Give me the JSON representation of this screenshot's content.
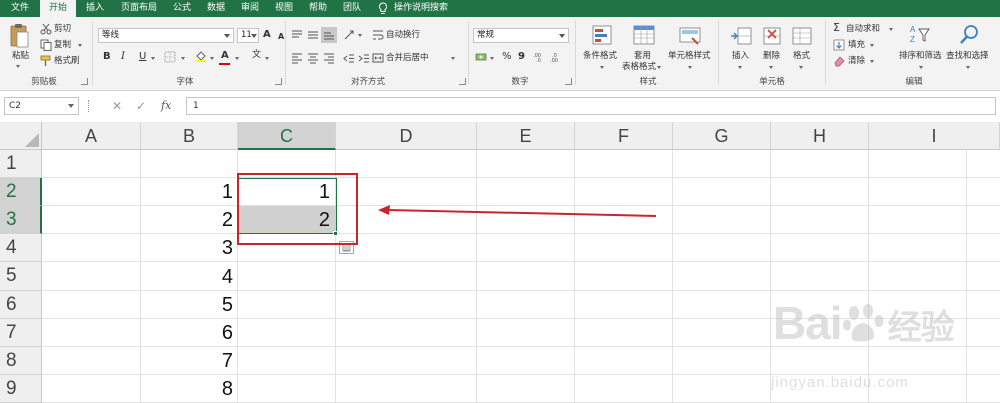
{
  "menu": {
    "tabs": [
      {
        "label": "文件"
      },
      {
        "label": "开始"
      },
      {
        "label": "插入"
      },
      {
        "label": "页面布局"
      },
      {
        "label": "公式"
      },
      {
        "label": "数据"
      },
      {
        "label": "审阅"
      },
      {
        "label": "视图"
      },
      {
        "label": "帮助"
      },
      {
        "label": "团队"
      }
    ],
    "tell_me": "操作说明搜索",
    "active_color": "#217346"
  },
  "ribbon": {
    "clipboard": {
      "paste": "粘贴",
      "cut": "剪切",
      "copy": "复制",
      "format_painter": "格式刷",
      "label": "剪贴板"
    },
    "font": {
      "name": "等线",
      "size": "11",
      "bold": "B",
      "italic": "I",
      "underline": "U",
      "grow": "A",
      "shrink": "A",
      "text_color_glyph": "A",
      "wen": "文",
      "label": "字体"
    },
    "alignment": {
      "wrap": "自动换行",
      "merge": "合并后居中",
      "label": "对齐方式"
    },
    "number": {
      "format": "常规",
      "percent": "%",
      "comma": "9",
      "label": "数字"
    },
    "styles": {
      "conditional": "条件格式",
      "table1": "套用",
      "table2": "表格格式",
      "cell_styles": "单元格样式",
      "label": "样式"
    },
    "cells": {
      "insert": "插入",
      "delete": "删除",
      "format": "格式",
      "label": "单元格"
    },
    "editing": {
      "autosum": "自动求和",
      "fill": "填充",
      "clear": "清除",
      "sort": "排序和筛选",
      "find": "查找和选择",
      "label": "编辑"
    }
  },
  "formula_bar": {
    "name_box": "C2",
    "cancel": "✕",
    "confirm": "✓",
    "fx": "fx",
    "value": "1"
  },
  "sheet": {
    "columns": [
      "A",
      "B",
      "C",
      "D",
      "E",
      "F",
      "G",
      "H",
      "I"
    ],
    "rows": [
      "1",
      "2",
      "3",
      "4",
      "5",
      "6",
      "7",
      "8",
      "9"
    ],
    "col_b": [
      "",
      "1",
      "2",
      "3",
      "4",
      "5",
      "6",
      "7",
      "8"
    ],
    "col_c": [
      "",
      "1",
      "2"
    ]
  },
  "watermark": {
    "brand": "Bai",
    "brand2": "经验",
    "url": "jingyan.baidu.com"
  },
  "colors": {
    "excel_green": "#217346",
    "annotation_red": "#c9252c",
    "font_red": "#e00000"
  }
}
